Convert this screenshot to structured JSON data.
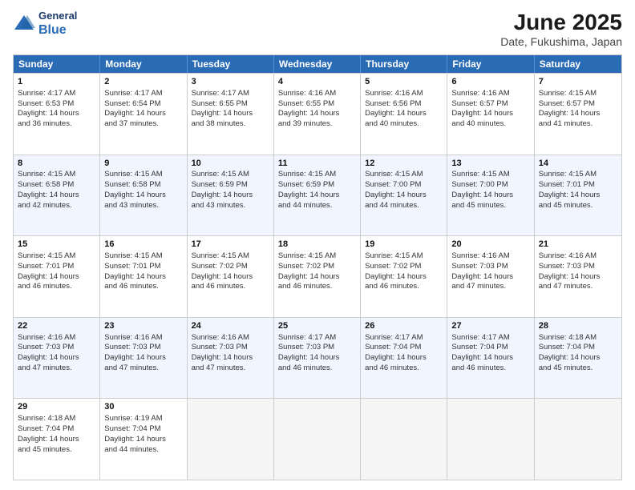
{
  "logo": {
    "general": "General",
    "blue": "Blue"
  },
  "title": "June 2025",
  "subtitle": "Date, Fukushima, Japan",
  "header_days": [
    "Sunday",
    "Monday",
    "Tuesday",
    "Wednesday",
    "Thursday",
    "Friday",
    "Saturday"
  ],
  "weeks": [
    [
      {
        "day": "1",
        "lines": [
          "Sunrise: 4:17 AM",
          "Sunset: 6:53 PM",
          "Daylight: 14 hours",
          "and 36 minutes."
        ]
      },
      {
        "day": "2",
        "lines": [
          "Sunrise: 4:17 AM",
          "Sunset: 6:54 PM",
          "Daylight: 14 hours",
          "and 37 minutes."
        ]
      },
      {
        "day": "3",
        "lines": [
          "Sunrise: 4:17 AM",
          "Sunset: 6:55 PM",
          "Daylight: 14 hours",
          "and 38 minutes."
        ]
      },
      {
        "day": "4",
        "lines": [
          "Sunrise: 4:16 AM",
          "Sunset: 6:55 PM",
          "Daylight: 14 hours",
          "and 39 minutes."
        ]
      },
      {
        "day": "5",
        "lines": [
          "Sunrise: 4:16 AM",
          "Sunset: 6:56 PM",
          "Daylight: 14 hours",
          "and 40 minutes."
        ]
      },
      {
        "day": "6",
        "lines": [
          "Sunrise: 4:16 AM",
          "Sunset: 6:57 PM",
          "Daylight: 14 hours",
          "and 40 minutes."
        ]
      },
      {
        "day": "7",
        "lines": [
          "Sunrise: 4:15 AM",
          "Sunset: 6:57 PM",
          "Daylight: 14 hours",
          "and 41 minutes."
        ]
      }
    ],
    [
      {
        "day": "8",
        "lines": [
          "Sunrise: 4:15 AM",
          "Sunset: 6:58 PM",
          "Daylight: 14 hours",
          "and 42 minutes."
        ]
      },
      {
        "day": "9",
        "lines": [
          "Sunrise: 4:15 AM",
          "Sunset: 6:58 PM",
          "Daylight: 14 hours",
          "and 43 minutes."
        ]
      },
      {
        "day": "10",
        "lines": [
          "Sunrise: 4:15 AM",
          "Sunset: 6:59 PM",
          "Daylight: 14 hours",
          "and 43 minutes."
        ]
      },
      {
        "day": "11",
        "lines": [
          "Sunrise: 4:15 AM",
          "Sunset: 6:59 PM",
          "Daylight: 14 hours",
          "and 44 minutes."
        ]
      },
      {
        "day": "12",
        "lines": [
          "Sunrise: 4:15 AM",
          "Sunset: 7:00 PM",
          "Daylight: 14 hours",
          "and 44 minutes."
        ]
      },
      {
        "day": "13",
        "lines": [
          "Sunrise: 4:15 AM",
          "Sunset: 7:00 PM",
          "Daylight: 14 hours",
          "and 45 minutes."
        ]
      },
      {
        "day": "14",
        "lines": [
          "Sunrise: 4:15 AM",
          "Sunset: 7:01 PM",
          "Daylight: 14 hours",
          "and 45 minutes."
        ]
      }
    ],
    [
      {
        "day": "15",
        "lines": [
          "Sunrise: 4:15 AM",
          "Sunset: 7:01 PM",
          "Daylight: 14 hours",
          "and 46 minutes."
        ]
      },
      {
        "day": "16",
        "lines": [
          "Sunrise: 4:15 AM",
          "Sunset: 7:01 PM",
          "Daylight: 14 hours",
          "and 46 minutes."
        ]
      },
      {
        "day": "17",
        "lines": [
          "Sunrise: 4:15 AM",
          "Sunset: 7:02 PM",
          "Daylight: 14 hours",
          "and 46 minutes."
        ]
      },
      {
        "day": "18",
        "lines": [
          "Sunrise: 4:15 AM",
          "Sunset: 7:02 PM",
          "Daylight: 14 hours",
          "and 46 minutes."
        ]
      },
      {
        "day": "19",
        "lines": [
          "Sunrise: 4:15 AM",
          "Sunset: 7:02 PM",
          "Daylight: 14 hours",
          "and 46 minutes."
        ]
      },
      {
        "day": "20",
        "lines": [
          "Sunrise: 4:16 AM",
          "Sunset: 7:03 PM",
          "Daylight: 14 hours",
          "and 47 minutes."
        ]
      },
      {
        "day": "21",
        "lines": [
          "Sunrise: 4:16 AM",
          "Sunset: 7:03 PM",
          "Daylight: 14 hours",
          "and 47 minutes."
        ]
      }
    ],
    [
      {
        "day": "22",
        "lines": [
          "Sunrise: 4:16 AM",
          "Sunset: 7:03 PM",
          "Daylight: 14 hours",
          "and 47 minutes."
        ]
      },
      {
        "day": "23",
        "lines": [
          "Sunrise: 4:16 AM",
          "Sunset: 7:03 PM",
          "Daylight: 14 hours",
          "and 47 minutes."
        ]
      },
      {
        "day": "24",
        "lines": [
          "Sunrise: 4:16 AM",
          "Sunset: 7:03 PM",
          "Daylight: 14 hours",
          "and 47 minutes."
        ]
      },
      {
        "day": "25",
        "lines": [
          "Sunrise: 4:17 AM",
          "Sunset: 7:03 PM",
          "Daylight: 14 hours",
          "and 46 minutes."
        ]
      },
      {
        "day": "26",
        "lines": [
          "Sunrise: 4:17 AM",
          "Sunset: 7:04 PM",
          "Daylight: 14 hours",
          "and 46 minutes."
        ]
      },
      {
        "day": "27",
        "lines": [
          "Sunrise: 4:17 AM",
          "Sunset: 7:04 PM",
          "Daylight: 14 hours",
          "and 46 minutes."
        ]
      },
      {
        "day": "28",
        "lines": [
          "Sunrise: 4:18 AM",
          "Sunset: 7:04 PM",
          "Daylight: 14 hours",
          "and 45 minutes."
        ]
      }
    ],
    [
      {
        "day": "29",
        "lines": [
          "Sunrise: 4:18 AM",
          "Sunset: 7:04 PM",
          "Daylight: 14 hours",
          "and 45 minutes."
        ]
      },
      {
        "day": "30",
        "lines": [
          "Sunrise: 4:19 AM",
          "Sunset: 7:04 PM",
          "Daylight: 14 hours",
          "and 44 minutes."
        ]
      },
      {
        "day": "",
        "lines": []
      },
      {
        "day": "",
        "lines": []
      },
      {
        "day": "",
        "lines": []
      },
      {
        "day": "",
        "lines": []
      },
      {
        "day": "",
        "lines": []
      }
    ]
  ]
}
